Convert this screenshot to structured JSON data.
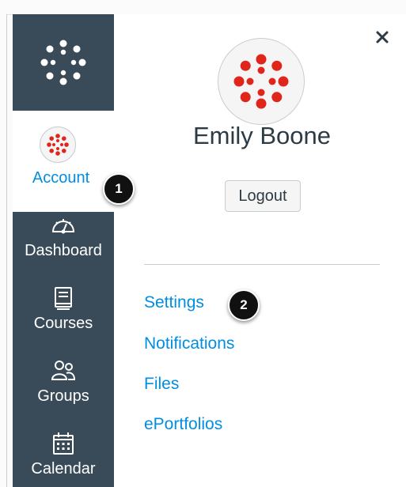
{
  "colors": {
    "sidebar_bg": "#394b58",
    "accent_link": "#008ee2",
    "brand_red": "#e0251b",
    "badge_bg": "#111111"
  },
  "sidebar": {
    "logo_icon": "canvas-logo-icon",
    "account": {
      "label": "Account",
      "icon": "user-avatar-icon"
    },
    "items": [
      {
        "label": "Dashboard",
        "icon": "dashboard-gauge-icon"
      },
      {
        "label": "Courses",
        "icon": "book-icon"
      },
      {
        "label": "Groups",
        "icon": "groups-icon"
      },
      {
        "label": "Calendar",
        "icon": "calendar-icon"
      }
    ]
  },
  "tray": {
    "close_icon": "close-icon",
    "user_name": "Emily Boone",
    "logout_label": "Logout",
    "links": [
      "Settings",
      "Notifications",
      "Files",
      "ePortfolios"
    ]
  },
  "callouts": [
    "1",
    "2"
  ]
}
